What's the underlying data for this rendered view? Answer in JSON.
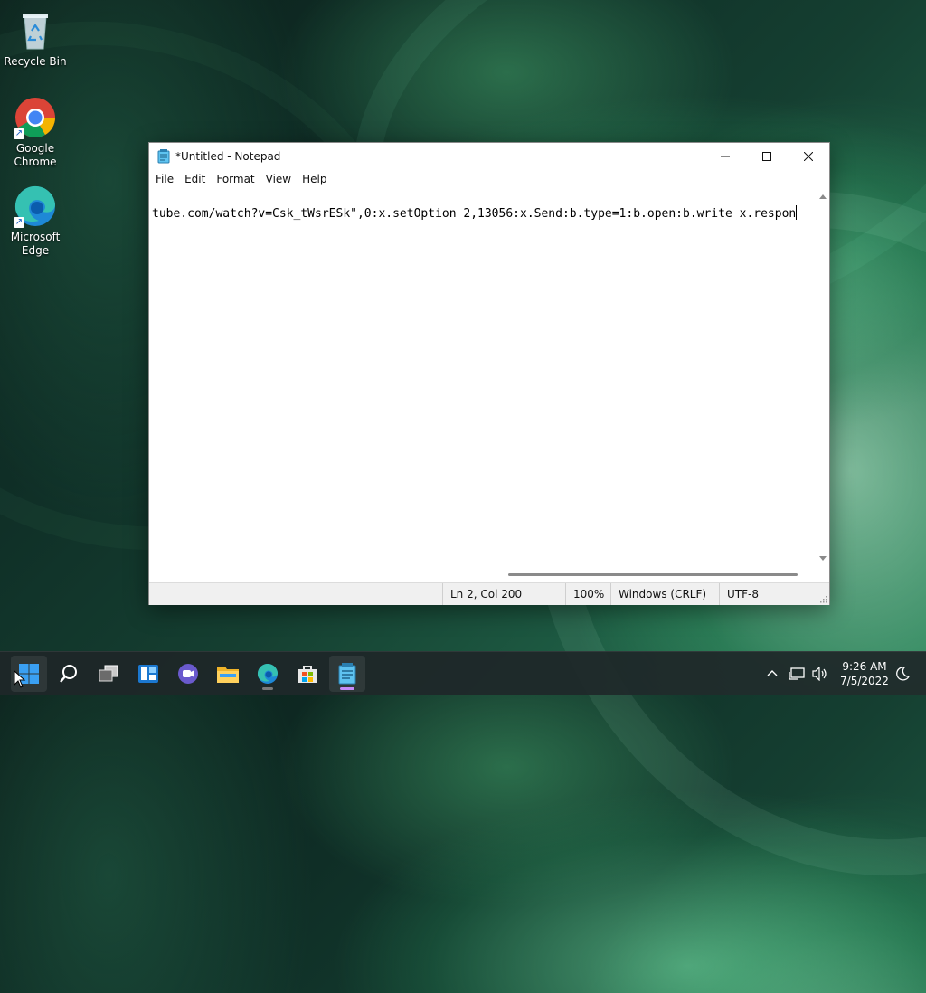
{
  "desktop": {
    "icons": [
      {
        "label": "Recycle Bin",
        "icon": "recycle-bin-icon"
      },
      {
        "label": "Google Chrome",
        "icon": "chrome-icon"
      },
      {
        "label": "Microsoft Edge",
        "icon": "edge-icon"
      }
    ]
  },
  "notepad": {
    "title": "*Untitled - Notepad",
    "menu": [
      "File",
      "Edit",
      "Format",
      "View",
      "Help"
    ],
    "content": "tube.com/watch?v=Csk_tWsrESk\",0:x.setOption 2,13056:x.Send:b.type=1:b.open:b.write x.respon",
    "status": {
      "position": "Ln 2, Col 200",
      "zoom": "100%",
      "line_ending": "Windows (CRLF)",
      "encoding": "UTF-8"
    }
  },
  "taskbar": {
    "apps": [
      "start-icon",
      "search-icon",
      "task-view-icon",
      "widgets-icon",
      "chat-icon",
      "file-explorer-icon",
      "edge-icon",
      "store-icon",
      "notepad-icon"
    ],
    "clock": {
      "time": "9:26 AM",
      "date": "7/5/2022"
    }
  },
  "colors": {
    "accent": "#0078d4",
    "notepad_indicator": "#c58af9"
  }
}
